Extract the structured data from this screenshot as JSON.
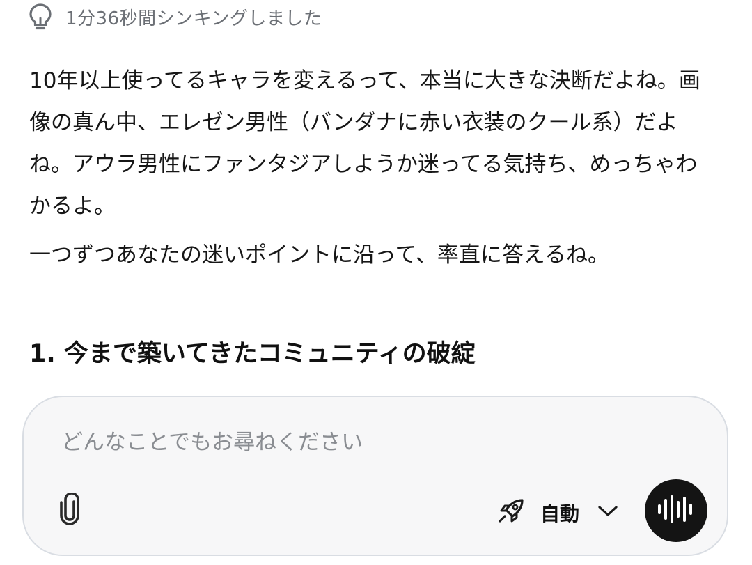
{
  "thinking": {
    "label": "1分36秒間シンキングしました",
    "icon": "lightbulb-icon"
  },
  "message": {
    "paragraphs": [
      [
        "10年以上使ってるキャラを変えるって、本当に大きな決断だよね。画",
        "像の真ん中、エレゼン男性（バンダナに赤い衣装のクール系）だよ",
        "ね。アウラ男性にファンタジアしようか迷ってる気持ち、めっちゃわ",
        "かるよ。"
      ],
      [
        "一つずつあなたの迷いポイントに沿って、率直に答えるね。"
      ]
    ],
    "heading": "1. 今まで築いてきたコミュニティの破綻"
  },
  "composer": {
    "placeholder": "どんなことでもお尋ねください",
    "value": "",
    "attach_icon": "paperclip-icon",
    "mode_icon": "rocket-icon",
    "mode_label": "自動",
    "dropdown_icon": "chevron-down-icon",
    "voice_icon": "voice-waveform-icon"
  },
  "colors": {
    "background": "#ffffff",
    "text": "#161616",
    "muted": "#6b6f75",
    "composer_bg": "#f7f7f8",
    "composer_border": "#d9dde3",
    "voice_button": "#141414"
  }
}
